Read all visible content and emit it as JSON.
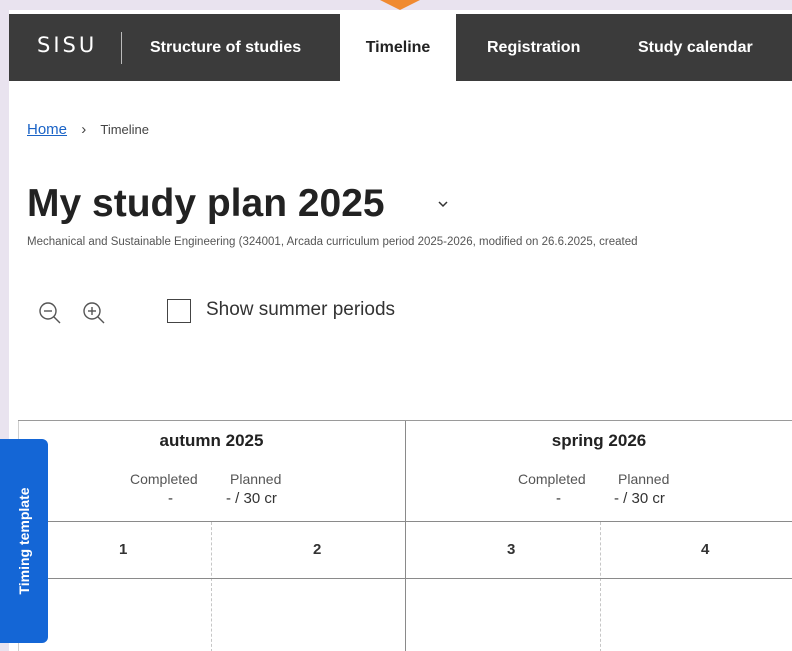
{
  "nav": {
    "logo": "SISU",
    "items": [
      {
        "label": "Structure of studies",
        "active": false
      },
      {
        "label": "Timeline",
        "active": true
      },
      {
        "label": "Registration",
        "active": false
      },
      {
        "label": "Study calendar",
        "active": false
      }
    ]
  },
  "breadcrumb": {
    "home": "Home",
    "current": "Timeline"
  },
  "plan": {
    "title": "My study plan 2025",
    "subtitle": "Mechanical and Sustainable Engineering (324001, Arcada curriculum period 2025-2026, modified on 26.6.2025, created"
  },
  "toolbar": {
    "zoom_out_icon": "zoom-out-icon",
    "zoom_in_icon": "zoom-in-icon",
    "summer_label": "Show summer periods",
    "summer_checked": false
  },
  "timeline": {
    "seasons": [
      {
        "name": "autumn 2025",
        "completed_label": "Completed",
        "completed_value": "-",
        "planned_label": "Planned",
        "planned_value": "- / 30 cr"
      },
      {
        "name": "spring 2026",
        "completed_label": "Completed",
        "completed_value": "-",
        "planned_label": "Planned",
        "planned_value": "- / 30 cr"
      }
    ],
    "periods": [
      "1",
      "2",
      "3",
      "4"
    ]
  },
  "sidetab": {
    "label": "Timing template"
  },
  "colors": {
    "topbar": "#3b3b3b",
    "link": "#1a63c6",
    "sidetab": "#1466d6",
    "pointer": "#f08a30"
  }
}
